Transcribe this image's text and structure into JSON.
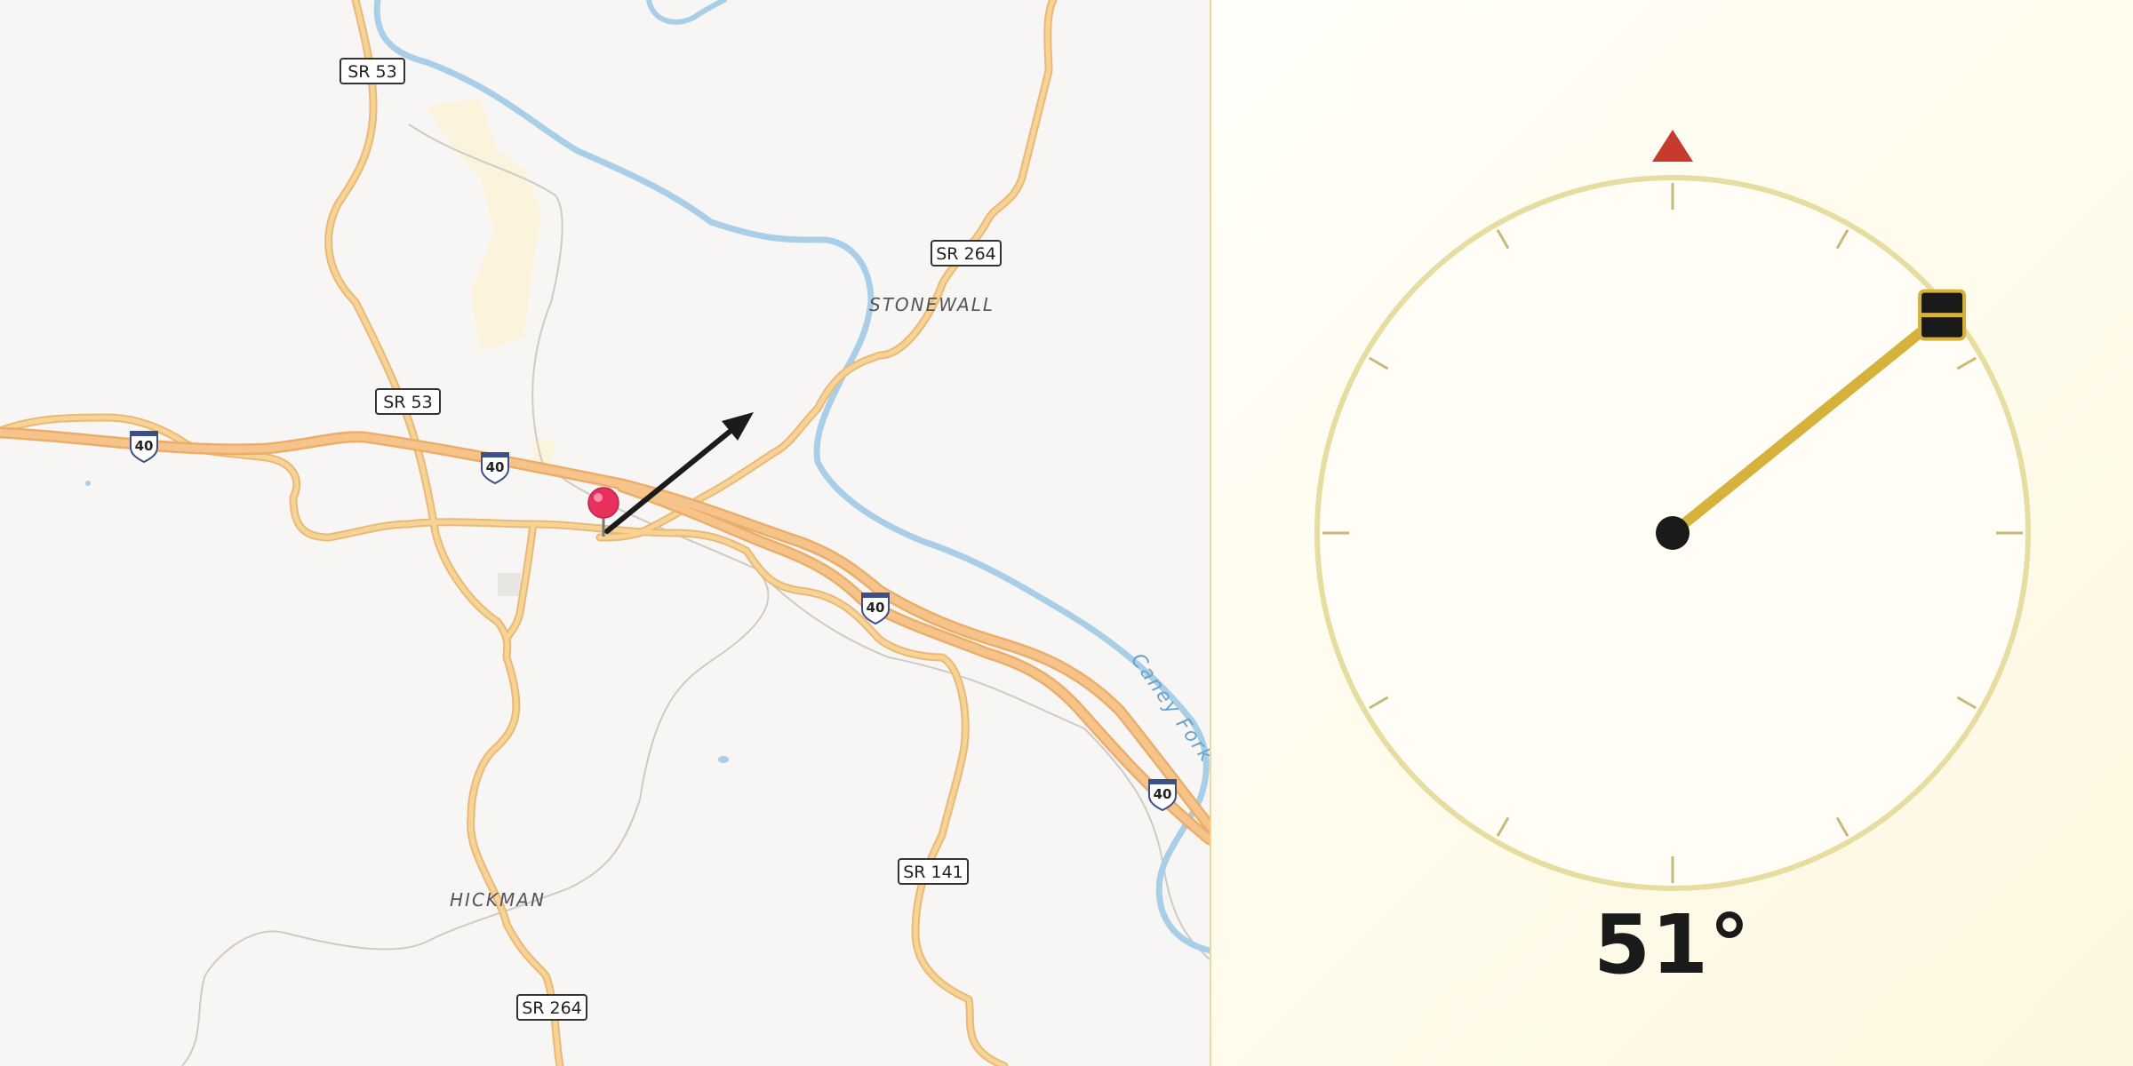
{
  "map": {
    "route_shields": [
      {
        "id": "sr53-top",
        "label": "SR 53"
      },
      {
        "id": "sr53-mid",
        "label": "SR 53"
      },
      {
        "id": "sr264-top",
        "label": "SR 264"
      },
      {
        "id": "sr141",
        "label": "SR 141"
      },
      {
        "id": "sr264-bottom",
        "label": "SR 264"
      }
    ],
    "interstate_shields": [
      {
        "id": "i40-a",
        "label": "40"
      },
      {
        "id": "i40-b",
        "label": "40"
      },
      {
        "id": "i40-c",
        "label": "40"
      },
      {
        "id": "i40-d",
        "label": "40"
      }
    ],
    "places": [
      {
        "id": "stonewall",
        "label": "STONEWALL"
      },
      {
        "id": "hickman",
        "label": "HICKMAN"
      }
    ],
    "water": {
      "river_label": "Caney Fork"
    },
    "colors": {
      "background": "#f8f6f4",
      "interstate": "#f6c48a",
      "road": "#f7d396",
      "river": "#a9cfe8",
      "pin": "#e8305c"
    }
  },
  "compass": {
    "heading_deg": 51,
    "heading_text": "51°",
    "colors": {
      "ring": "#e7dda0",
      "tick": "#c9b878",
      "needle": "#d4b23c",
      "north_marker": "#c63b2e",
      "hub": "#1a1a1a"
    }
  }
}
